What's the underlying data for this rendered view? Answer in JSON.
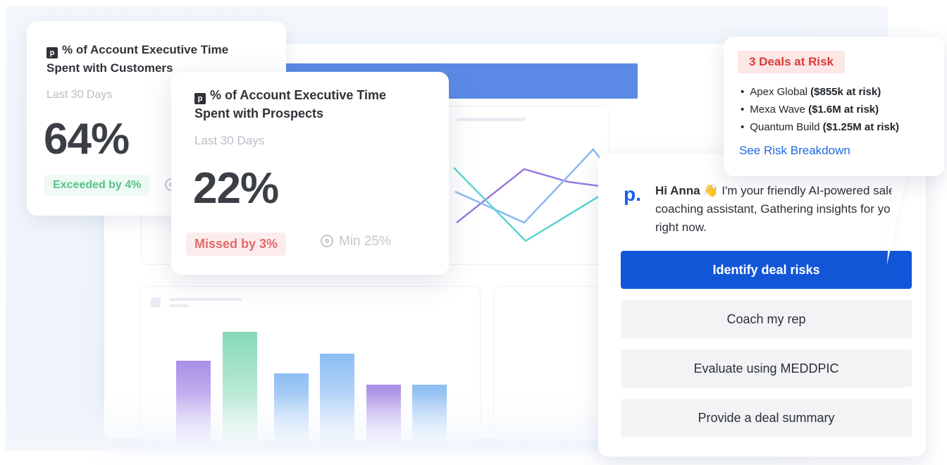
{
  "metric_card_1": {
    "title": "% of Account Executive Time Spent with Customers",
    "period": "Last 30 Days",
    "value": "64%",
    "status": "Exceeded by 4%",
    "status_color": "#54c28a"
  },
  "metric_card_2": {
    "title": "% of Account Executive Time Spent with Prospects",
    "period": "Last 30 Days",
    "value": "22%",
    "status": "Missed by 3%",
    "status_color": "#e06a6a",
    "target": "Min 25%"
  },
  "risk_popup": {
    "heading": "3 Deals at Risk",
    "deals": [
      {
        "name": "Apex Global",
        "risk": "($855k at risk)"
      },
      {
        "name": "Mexa Wave",
        "risk": "($1.6M at risk)"
      },
      {
        "name": "Quantum Build",
        "risk": "($1.25M at risk)"
      }
    ],
    "link": "See Risk Breakdown"
  },
  "assistant": {
    "logo": "p.",
    "greeting_name": "Hi Anna",
    "greeting_emoji": "👋",
    "greeting_text": "I'm your friendly AI-powered sales coaching assistant, Gathering insights for you right now.",
    "actions": [
      {
        "label": "Identify deal risks"
      },
      {
        "label": "Coach my rep"
      },
      {
        "label": "Evaluate using MEDDPIC"
      },
      {
        "label": "Provide a deal summary"
      }
    ]
  },
  "colors": {
    "primary": "#1256d8",
    "risk": "#d93a3a",
    "header_bar": "#5b8ae6",
    "line_purple": "#9a7be0",
    "line_blue": "#8ab8f0",
    "line_teal": "#5fd4d0",
    "bar_purple": "#b9a3ec",
    "bar_green": "#8fdcbf",
    "bar_blue": "#9ec7f5"
  }
}
